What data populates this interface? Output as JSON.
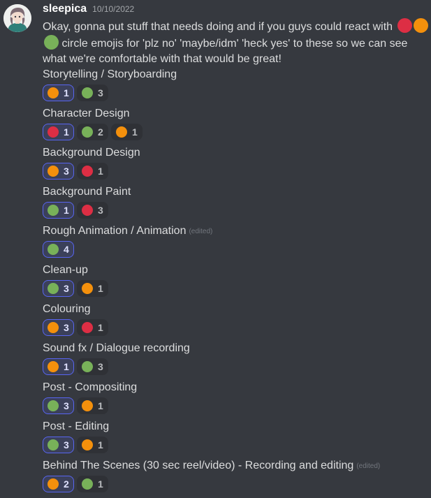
{
  "colors": {
    "red": "#dd2e44",
    "orange": "#f4900c",
    "green": "#78b159",
    "accent": "#5865f2"
  },
  "message": {
    "username": "sleepica",
    "timestamp": "10/10/2022",
    "intro_text": "Okay, gonna put stuff that needs doing and if you guys could react with",
    "intro_emojis": [
      "red-circle",
      "orange-circle",
      "green-circle"
    ],
    "intro_text_after": "circle emojis for 'plz no' 'maybe/idm' 'heck yes' to these so we can see what we're comfortable with that would be great!",
    "edited_label": "(edited)"
  },
  "tasks": [
    {
      "title": "Storytelling / Storyboarding",
      "edited": false,
      "reactions": [
        {
          "emoji": "orange-circle",
          "count": 1,
          "mine": true
        },
        {
          "emoji": "green-circle",
          "count": 3,
          "mine": false
        }
      ]
    },
    {
      "title": "Character Design",
      "edited": false,
      "reactions": [
        {
          "emoji": "red-circle",
          "count": 1,
          "mine": true
        },
        {
          "emoji": "green-circle",
          "count": 2,
          "mine": false
        },
        {
          "emoji": "orange-circle",
          "count": 1,
          "mine": false
        }
      ]
    },
    {
      "title": "Background Design",
      "edited": false,
      "reactions": [
        {
          "emoji": "orange-circle",
          "count": 3,
          "mine": true
        },
        {
          "emoji": "red-circle",
          "count": 1,
          "mine": false
        }
      ]
    },
    {
      "title": "Background Paint",
      "edited": false,
      "reactions": [
        {
          "emoji": "green-circle",
          "count": 1,
          "mine": true
        },
        {
          "emoji": "red-circle",
          "count": 3,
          "mine": false
        }
      ]
    },
    {
      "title": "Rough Animation / Animation",
      "edited": true,
      "reactions": [
        {
          "emoji": "green-circle",
          "count": 4,
          "mine": true
        }
      ]
    },
    {
      "title": "Clean-up",
      "edited": false,
      "reactions": [
        {
          "emoji": "green-circle",
          "count": 3,
          "mine": true
        },
        {
          "emoji": "orange-circle",
          "count": 1,
          "mine": false
        }
      ]
    },
    {
      "title": "Colouring",
      "edited": false,
      "reactions": [
        {
          "emoji": "orange-circle",
          "count": 3,
          "mine": true
        },
        {
          "emoji": "red-circle",
          "count": 1,
          "mine": false
        }
      ]
    },
    {
      "title": "Sound fx / Dialogue recording",
      "edited": false,
      "reactions": [
        {
          "emoji": "orange-circle",
          "count": 1,
          "mine": true
        },
        {
          "emoji": "green-circle",
          "count": 3,
          "mine": false
        }
      ]
    },
    {
      "title": "Post - Compositing",
      "edited": false,
      "reactions": [
        {
          "emoji": "green-circle",
          "count": 3,
          "mine": true
        },
        {
          "emoji": "orange-circle",
          "count": 1,
          "mine": false
        }
      ]
    },
    {
      "title": "Post - Editing",
      "edited": false,
      "reactions": [
        {
          "emoji": "green-circle",
          "count": 3,
          "mine": true
        },
        {
          "emoji": "orange-circle",
          "count": 1,
          "mine": false
        }
      ]
    },
    {
      "title": "Behind The Scenes (30 sec reel/video) - Recording and editing",
      "edited": true,
      "reactions": [
        {
          "emoji": "orange-circle",
          "count": 2,
          "mine": true
        },
        {
          "emoji": "green-circle",
          "count": 1,
          "mine": false
        }
      ]
    }
  ]
}
